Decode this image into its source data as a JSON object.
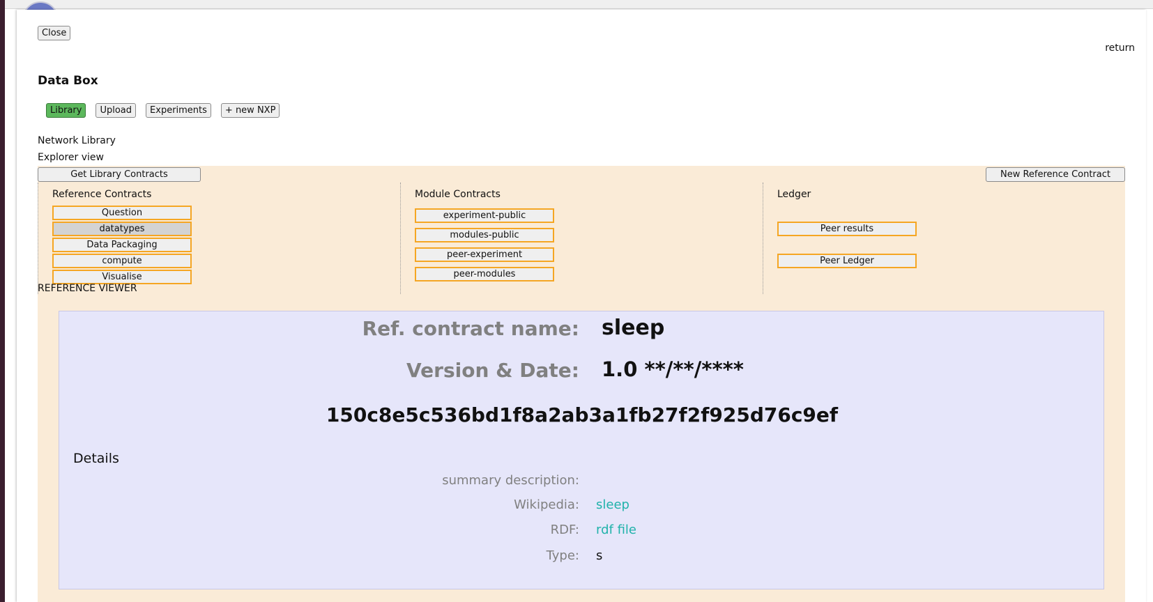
{
  "modal": {
    "close_label": "Close",
    "return_label": "return",
    "title": "Data Box"
  },
  "nav": {
    "library": "Library",
    "upload": "Upload",
    "experiments": "Experiments",
    "new_nxp": "+ new NXP",
    "active_color": "#5cb85c"
  },
  "library": {
    "network_label": "Network Library",
    "explorer_label": "Explorer view",
    "get_contracts": "Get Library Contracts",
    "new_reference": "New Reference Contract",
    "reference_viewer_label": "REFERENCE VIEWER"
  },
  "reference_contracts": {
    "heading": "Reference Contracts",
    "items": [
      "Question",
      "datatypes",
      "Data Packaging",
      "compute",
      "Visualise"
    ],
    "selected": "datatypes"
  },
  "module_contracts": {
    "heading": "Module Contracts",
    "items": [
      "experiment-public",
      "modules-public",
      "peer-experiment",
      "peer-modules"
    ]
  },
  "ledger": {
    "heading": "Ledger",
    "items": [
      "Peer results",
      "Peer Ledger"
    ]
  },
  "viewer": {
    "name_label": "Ref. contract name:",
    "name_value": "sleep",
    "version_label": "Version & Date:",
    "version_value": "1.0 **/**/****",
    "hash": "150c8e5c536bd1f8a2ab3a1fb27f2f925d76c9ef",
    "details_label": "Details",
    "summary_label": "summary description:",
    "wikipedia_label": "Wikipedia:",
    "wikipedia_value": "sleep",
    "rdf_label": "RDF:",
    "rdf_value": "rdf file",
    "type_label": "Type:",
    "type_value": "s"
  },
  "colors": {
    "explorer_bg": "#faebd7",
    "viewer_bg": "#e6e6fa",
    "button_border": "#f5a623",
    "link": "#20b2aa"
  }
}
